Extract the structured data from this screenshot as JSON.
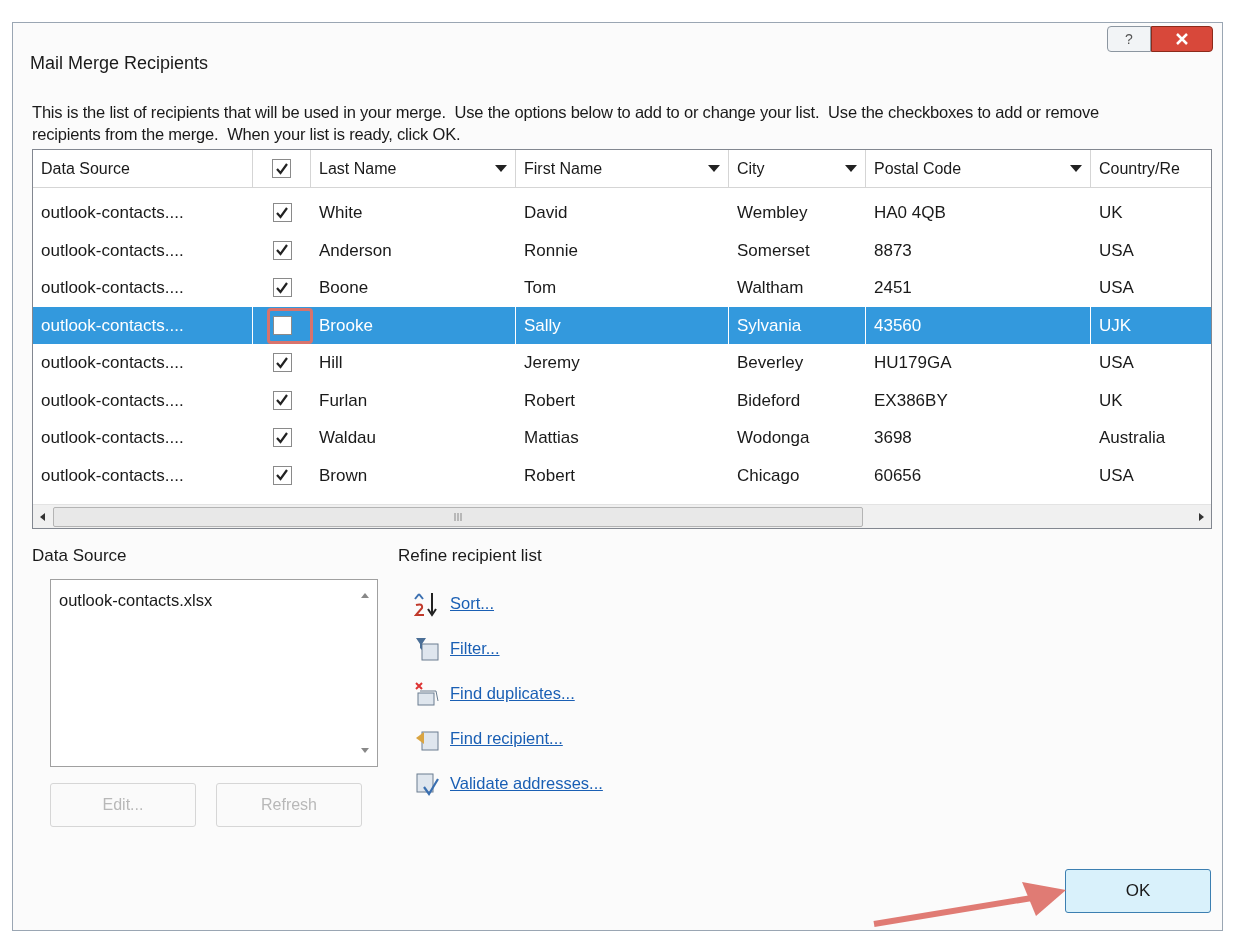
{
  "window": {
    "title": "Mail Merge Recipients",
    "help": "?"
  },
  "description": "This is the list of recipients that will be used in your merge.  Use the options below to add to or change your list.  Use the checkboxes to add or remove recipients from the merge.  When your list is ready, click OK.",
  "table": {
    "header_checked": true,
    "columns": [
      {
        "label": "Data Source",
        "kind": "text",
        "dropdown": false
      },
      {
        "kind": "check"
      },
      {
        "label": "Last Name",
        "kind": "text",
        "dropdown": true
      },
      {
        "label": "First Name",
        "kind": "text",
        "dropdown": true
      },
      {
        "label": "City",
        "kind": "text",
        "dropdown": true
      },
      {
        "label": "Postal Code",
        "kind": "text",
        "dropdown": true
      },
      {
        "label": "Country/Re",
        "kind": "text",
        "dropdown": false
      }
    ],
    "rows": [
      {
        "cells": [
          "outlook-contacts....",
          "",
          "White",
          "David",
          "Wembley",
          "HA0 4QB",
          "UK"
        ],
        "checked": true,
        "selected": false
      },
      {
        "cells": [
          "outlook-contacts....",
          "",
          "Anderson",
          "Ronnie",
          "Somerset",
          "8873",
          "USA"
        ],
        "checked": true,
        "selected": false
      },
      {
        "cells": [
          "outlook-contacts....",
          "",
          "Boone",
          "Tom",
          "Waltham",
          "2451",
          "USA"
        ],
        "checked": true,
        "selected": false
      },
      {
        "cells": [
          "outlook-contacts....",
          "",
          "Brooke",
          "Sally",
          "Sylvania",
          "43560",
          "UJK"
        ],
        "checked": false,
        "selected": true
      },
      {
        "cells": [
          "outlook-contacts....",
          "",
          "Hill",
          "Jeremy",
          "Beverley",
          "HU179GA",
          "USA"
        ],
        "checked": true,
        "selected": false
      },
      {
        "cells": [
          "outlook-contacts....",
          "",
          "Furlan",
          "Robert",
          "Bideford",
          "EX386BY",
          "UK"
        ],
        "checked": true,
        "selected": false
      },
      {
        "cells": [
          "outlook-contacts....",
          "",
          "Waldau",
          "Mattias",
          "Wodonga",
          "3698",
          "Australia"
        ],
        "checked": true,
        "selected": false
      },
      {
        "cells": [
          "outlook-contacts....",
          "",
          "Brown",
          "Robert",
          "Chicago",
          "60656",
          "USA"
        ],
        "checked": true,
        "selected": false
      }
    ]
  },
  "data_source": {
    "label": "Data Source",
    "items": [
      "outlook-contacts.xlsx"
    ],
    "buttons": [
      {
        "label": "Edit...",
        "disabled": true
      },
      {
        "label": "Refresh",
        "disabled": true
      }
    ]
  },
  "refine": {
    "label": "Refine recipient list",
    "links": [
      {
        "label": "Sort...",
        "kind": "sort"
      },
      {
        "label": "Filter...",
        "kind": "filter"
      },
      {
        "label": "Find duplicates...",
        "kind": "duplicates"
      },
      {
        "label": "Find recipient...",
        "kind": "find"
      },
      {
        "label": "Validate addresses...",
        "kind": "validate"
      }
    ]
  },
  "ok_button": "OK"
}
